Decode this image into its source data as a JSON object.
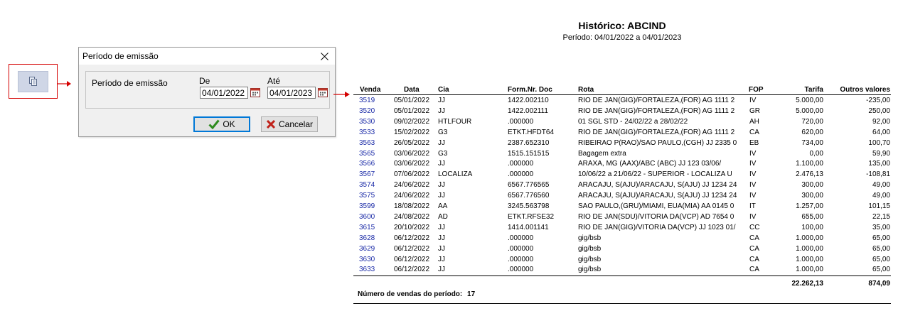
{
  "toolbar": {
    "icon": "copy-pages-icon"
  },
  "dialog": {
    "title": "Período de emissão",
    "group_label": "Período de emissão",
    "de_label": "De",
    "ate_label": "Até",
    "de_value": "04/01/2022",
    "ate_value": "04/01/2023",
    "ok_label": "OK",
    "cancel_label": "Cancelar"
  },
  "report": {
    "title": "Histórico: ABCIND",
    "subtitle": "Período: 04/01/2022 a 04/01/2023",
    "columns": {
      "venda": "Venda",
      "data": "Data",
      "cia": "Cia",
      "doc": "Form.Nr. Doc",
      "rota": "Rota",
      "fop": "FOP",
      "tarifa": "Tarifa",
      "outros": "Outros valores"
    },
    "rows": [
      {
        "venda": "3519",
        "data": "05/01/2022",
        "cia": "JJ",
        "doc": "1422.002110",
        "rota": "RIO DE JAN(GIG)/FORTALEZA,(FOR) AG 1111 2",
        "fop": "IV",
        "tarifa": "5.000,00",
        "outros": "-235,00"
      },
      {
        "venda": "3520",
        "data": "05/01/2022",
        "cia": "JJ",
        "doc": "1422.002111",
        "rota": "RIO DE JAN(GIG)/FORTALEZA,(FOR) AG 1111 2",
        "fop": "GR",
        "tarifa": "5.000,00",
        "outros": "250,00"
      },
      {
        "venda": "3530",
        "data": "09/02/2022",
        "cia": "HTLFOUR",
        "doc": ".000000",
        "rota": "01 SGL STD - 24/02/22 a 28/02/22",
        "fop": "AH",
        "tarifa": "720,00",
        "outros": "92,00"
      },
      {
        "venda": "3533",
        "data": "15/02/2022",
        "cia": "G3",
        "doc": "ETKT.HFDT64",
        "rota": "RIO DE JAN(GIG)/FORTALEZA,(FOR) AG 1111 2",
        "fop": "CA",
        "tarifa": "620,00",
        "outros": "64,00"
      },
      {
        "venda": "3563",
        "data": "26/05/2022",
        "cia": "JJ",
        "doc": "2387.652310",
        "rota": "RIBEIRAO P(RAO)/SAO PAULO,(CGH) JJ 2335 0",
        "fop": "EB",
        "tarifa": "734,00",
        "outros": "100,70"
      },
      {
        "venda": "3565",
        "data": "03/06/2022",
        "cia": "G3",
        "doc": "1515.151515",
        "rota": "Bagagem extra",
        "fop": "IV",
        "tarifa": "0,00",
        "outros": "59,90"
      },
      {
        "venda": "3566",
        "data": "03/06/2022",
        "cia": "JJ",
        "doc": ".000000",
        "rota": "ARAXA, MG (AAX)/ABC      (ABC) JJ  123 03/06/",
        "fop": "IV",
        "tarifa": "1.100,00",
        "outros": "135,00"
      },
      {
        "venda": "3567",
        "data": "07/06/2022",
        "cia": "LOCALIZA",
        "doc": ".000000",
        "rota": "10/06/22 a 21/06/22 - SUPERIOR - LOCALIZA U",
        "fop": "IV",
        "tarifa": "2.476,13",
        "outros": "-108,81"
      },
      {
        "venda": "3574",
        "data": "24/06/2022",
        "cia": "JJ",
        "doc": "6567.776565",
        "rota": "ARACAJU, S(AJU)/ARACAJU, S(AJU) JJ 1234 24",
        "fop": "IV",
        "tarifa": "300,00",
        "outros": "49,00"
      },
      {
        "venda": "3575",
        "data": "24/06/2022",
        "cia": "JJ",
        "doc": "6567.776560",
        "rota": "ARACAJU, S(AJU)/ARACAJU, S(AJU) JJ 1234 24",
        "fop": "IV",
        "tarifa": "300,00",
        "outros": "49,00"
      },
      {
        "venda": "3599",
        "data": "18/08/2022",
        "cia": "AA",
        "doc": "3245.563798",
        "rota": "SAO PAULO,(GRU)/MIAMI, EUA(MIA) AA 0145 0",
        "fop": "IT",
        "tarifa": "1.257,00",
        "outros": "101,15"
      },
      {
        "venda": "3600",
        "data": "24/08/2022",
        "cia": "AD",
        "doc": "ETKT.RFSE32",
        "rota": "RIO DE JAN(SDU)/VITORIA DA(VCP) AD 7654 0",
        "fop": "IV",
        "tarifa": "655,00",
        "outros": "22,15"
      },
      {
        "venda": "3615",
        "data": "20/10/2022",
        "cia": "JJ",
        "doc": "1414.001141",
        "rota": "RIO DE JAN(GIG)/VITORIA DA(VCP) JJ 1023 01/",
        "fop": "CC",
        "tarifa": "100,00",
        "outros": "35,00"
      },
      {
        "venda": "3628",
        "data": "06/12/2022",
        "cia": "JJ",
        "doc": ".000000",
        "rota": "gig/bsb",
        "fop": "CA",
        "tarifa": "1.000,00",
        "outros": "65,00"
      },
      {
        "venda": "3629",
        "data": "06/12/2022",
        "cia": "JJ",
        "doc": ".000000",
        "rota": "gig/bsb",
        "fop": "CA",
        "tarifa": "1.000,00",
        "outros": "65,00"
      },
      {
        "venda": "3630",
        "data": "06/12/2022",
        "cia": "JJ",
        "doc": ".000000",
        "rota": "gig/bsb",
        "fop": "CA",
        "tarifa": "1.000,00",
        "outros": "65,00"
      },
      {
        "venda": "3633",
        "data": "06/12/2022",
        "cia": "JJ",
        "doc": ".000000",
        "rota": "gig/bsb",
        "fop": "CA",
        "tarifa": "1.000,00",
        "outros": "65,00"
      }
    ],
    "total_tarifa": "22.262,13",
    "total_outros": "874,09",
    "footer_label": "Número de vendas do período:",
    "footer_count": "17"
  },
  "colors": {
    "accent_red": "#d40000",
    "link_blue": "#1c2ca8",
    "ok_border": "#0078d7"
  }
}
